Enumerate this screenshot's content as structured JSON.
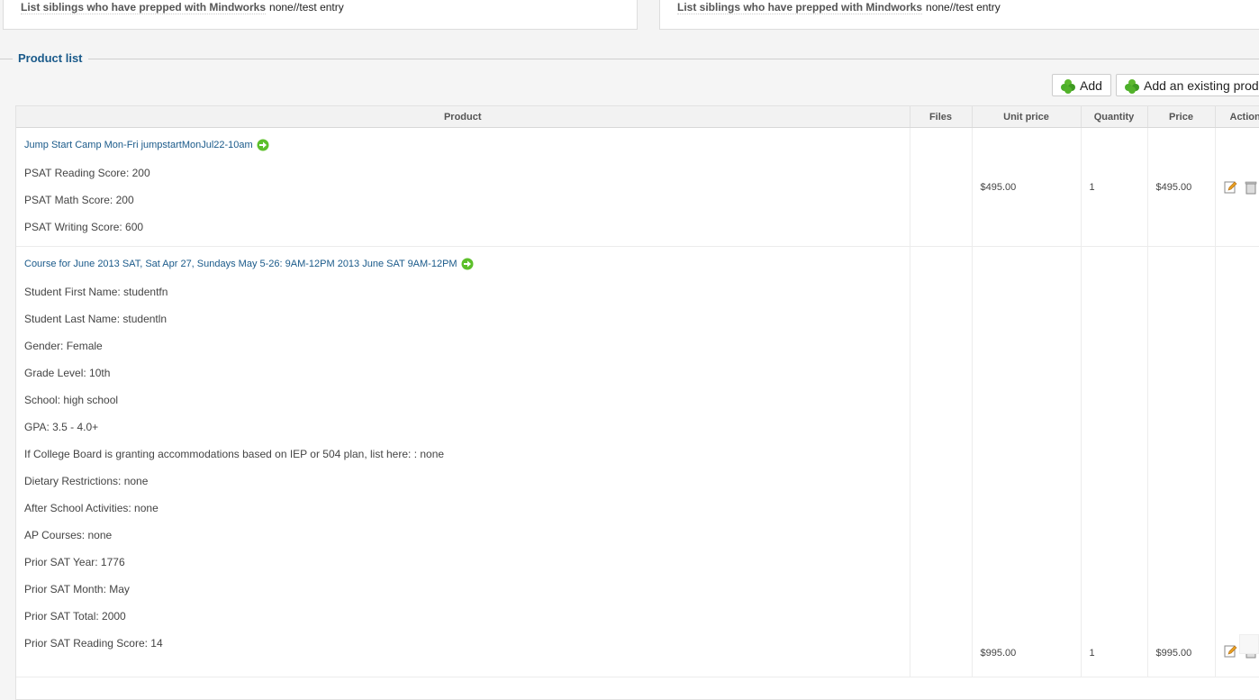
{
  "siblings": {
    "label": "List siblings who have prepped with Mindworks",
    "left_value": "none//test entry",
    "right_value": "none//test entry"
  },
  "section": {
    "legend": "Product list"
  },
  "toolbar": {
    "add_label": "Add",
    "add_existing_label": "Add an existing produ"
  },
  "table": {
    "headers": {
      "product": "Product",
      "files": "Files",
      "unit_price": "Unit price",
      "quantity": "Quantity",
      "price": "Price",
      "actions": "Action"
    },
    "rows": [
      {
        "title": "Jump Start Camp Mon-Fri jumpstartMonJul22-10am",
        "attrs": [
          "PSAT Reading Score: 200",
          "PSAT Math Score: 200",
          "PSAT Writing Score: 600"
        ],
        "unit_price": "$495.00",
        "quantity": "1",
        "price": "$495.00"
      },
      {
        "title": "Course for June 2013 SAT, Sat Apr 27, Sundays May 5-26: 9AM-12PM 2013 June SAT 9AM-12PM",
        "attrs": [
          "Student First Name: studentfn",
          "Student Last Name: studentln",
          "Gender: Female",
          "Grade Level: 10th",
          "School: high school",
          "GPA: 3.5 - 4.0+",
          "If College Board is granting accommodations based on IEP or 504 plan, list here: : none",
          "Dietary Restrictions: none",
          "After School Activities: none",
          "AP Courses: none",
          "Prior SAT Year: 1776",
          "Prior SAT Month: May",
          "Prior SAT Total: 2000",
          "Prior SAT Reading Score: 14"
        ],
        "unit_price": "$995.00",
        "quantity": "1",
        "price": "$995.00"
      }
    ]
  },
  "icons": {
    "add": "plus-icon",
    "link": "arrow-right-icon",
    "edit": "edit-icon",
    "delete": "trash-icon"
  },
  "colors": {
    "accent": "#1a5a8a",
    "plus_green": "#4caf2a"
  }
}
